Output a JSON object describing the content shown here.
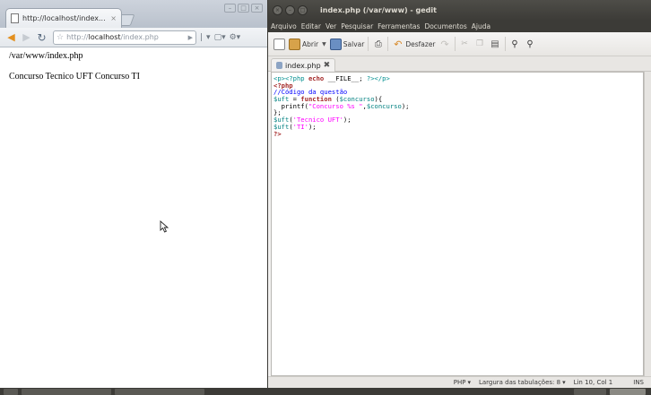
{
  "browser": {
    "tab_title": "http://localhost/index...",
    "tab_close": "×",
    "url_host": "http://localhost",
    "url_host_bold": "localhost",
    "url_path": "/index.php",
    "url_scheme": "http://",
    "content_lines": [
      "/var/www/index.php",
      "Concurso Tecnico UFT Concurso TI"
    ]
  },
  "gedit": {
    "window_title": "index.php (/var/www) - gedit",
    "menu": [
      "Arquivo",
      "Editar",
      "Ver",
      "Pesquisar",
      "Ferramentas",
      "Documentos",
      "Ajuda"
    ],
    "toolbar": {
      "open_label": "Abrir",
      "save_label": "Salvar",
      "undo_label": "Desfazer"
    },
    "tab_label": "index.php",
    "code": {
      "l1a": "<p><?php",
      "l1b": " echo ",
      "l1c": "__FILE__",
      "l1d": "; ",
      "l1e": "?></p>",
      "l2": "<?php",
      "l3": "//Código da questão",
      "l4a": "$uft",
      "l4b": " = ",
      "l4c": "function",
      "l4d": " (",
      "l4e": "$concurso",
      "l4f": "){",
      "l5a": "  printf(",
      "l5b": "\"Concurso %s \"",
      "l5c": ",",
      "l5d": "$concurso",
      "l5e": ");",
      "l6": "};",
      "l7a": "$uft",
      "l7b": "(",
      "l7c": "'Tecnico UFT'",
      "l7d": ");",
      "l8a": "$uft",
      "l8b": "(",
      "l8c": "'TI'",
      "l8d": ");",
      "l9": "?>"
    },
    "status": {
      "language": "PHP",
      "tab_width": "Largura das tabulações: 8",
      "position": "Lin 10, Col 1",
      "mode": "INS"
    }
  },
  "colors": {
    "php_tag": "#008f8f",
    "keyword": "#a52a2a",
    "comment": "#0000ff",
    "variable": "#008080",
    "string": "#ff00ff"
  }
}
